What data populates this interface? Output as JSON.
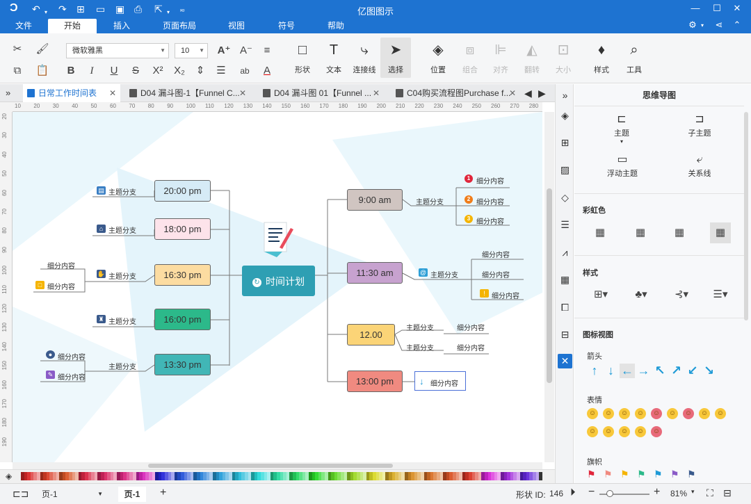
{
  "app": {
    "title": "亿图图示"
  },
  "menu": {
    "tabs": [
      "文件",
      "开始",
      "插入",
      "页面布局",
      "视图",
      "符号",
      "帮助"
    ],
    "active": "开始"
  },
  "ribbon": {
    "font_name": "微软雅黑",
    "font_size": "10",
    "buttons": {
      "shape": "形状",
      "text": "文本",
      "connector": "连接线",
      "select": "选择",
      "position": "位置",
      "group": "组合",
      "align": "对齐",
      "flip": "翻转",
      "size": "大小",
      "style": "样式",
      "tools": "工具"
    }
  },
  "doc_tabs": [
    "日常工作时间表",
    "D04 漏斗图-1【Funnel C...",
    "D04 漏斗图 01【Funnel ...",
    "C04购买流程图Purchase f..."
  ],
  "ruler": {
    "h": [
      "10",
      "20",
      "30",
      "40",
      "50",
      "60",
      "70",
      "80",
      "90",
      "100",
      "110",
      "120",
      "130",
      "140",
      "150",
      "160",
      "170",
      "180",
      "190",
      "200",
      "210",
      "220",
      "230",
      "240",
      "250",
      "260",
      "270",
      "280"
    ],
    "v": [
      "20",
      "30",
      "40",
      "50",
      "60",
      "70",
      "80",
      "90",
      "100",
      "110",
      "120",
      "130",
      "140",
      "150",
      "160",
      "170",
      "180",
      "190"
    ]
  },
  "mindmap": {
    "center": "时间计划",
    "left": [
      {
        "time": "20:00 pm",
        "branch": "主题分支",
        "color": "#d6ebf6"
      },
      {
        "time": "18:00 pm",
        "branch": "主题分支",
        "color": "#fde3ea"
      },
      {
        "time": "16:30 pm",
        "branch": "主题分支",
        "color": "#fcdca1",
        "details": [
          "细分内容",
          "细分内容"
        ]
      },
      {
        "time": "16:00 pm",
        "branch": "主题分支",
        "color": "#2cb98a"
      },
      {
        "time": "13:30 pm",
        "branch": "主题分支",
        "color": "#41b6b6",
        "details": [
          "细分内容",
          "细分内容"
        ]
      }
    ],
    "right": [
      {
        "time": "9:00 am",
        "branch": "主题分支",
        "color": "#d0c5c1",
        "details": [
          "细分内容",
          "细分内容",
          "细分内容"
        ]
      },
      {
        "time": "11:30 am",
        "branch": "主题分支",
        "color": "#c7a2cf",
        "details": [
          "细分内容",
          "细分内容",
          "细分内容"
        ]
      },
      {
        "time": "12.00",
        "branches": [
          "主题分支",
          "主题分支"
        ],
        "color": "#fbd477",
        "details": [
          "细分内容",
          "细分内容"
        ]
      },
      {
        "time": "13:00 pm",
        "detail": "细分内容",
        "color": "#f08a80"
      }
    ]
  },
  "right_panel": {
    "title": "思维导图",
    "actions": [
      "主题",
      "子主题",
      "浮动主题",
      "关系线"
    ],
    "sections": {
      "rainbow": "彩虹色",
      "style": "样式",
      "icon_view": "图标视图",
      "arrow": "箭头",
      "emotion": "表情",
      "flag": "旗帜"
    }
  },
  "status": {
    "page_select": "页-1",
    "page_tab": "页-1",
    "add": "+",
    "shape_id_label": "形状 ID:",
    "shape_id": "146",
    "zoom": "81%"
  }
}
